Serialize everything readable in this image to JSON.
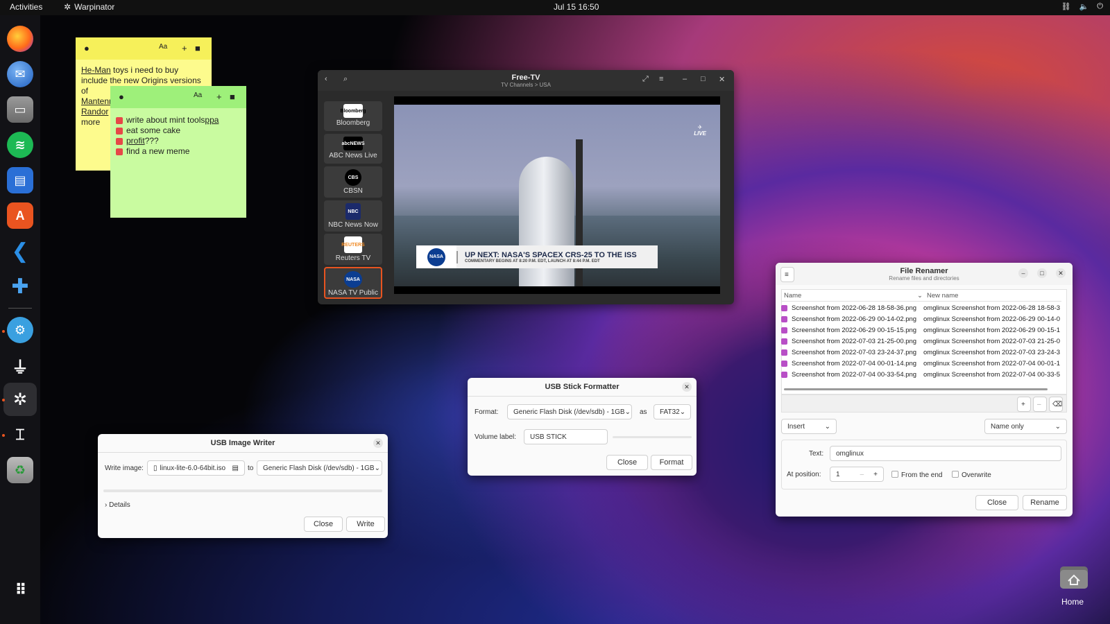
{
  "topbar": {
    "activities": "Activities",
    "app_name": "Warpinator",
    "clock": "Jul 15  16:50"
  },
  "dock": {
    "apps": [
      "firefox-icon",
      "thunderbird-icon",
      "files-icon",
      "spotify-icon",
      "writer-icon",
      "software-icon",
      "vscode-icon",
      "extensions-icon",
      "gear-icon",
      "usb-icon",
      "warpinator-icon",
      "renamer-icon",
      "trash-icon",
      "show-apps-icon"
    ]
  },
  "note_yellow": {
    "color": "#fdfb8d",
    "lines": [
      "He-Man",
      " toys i need to buy include the new Origins versions of ",
      "Mantenna",
      "Randor",
      "more"
    ]
  },
  "note_green": {
    "color": "#c9fba0",
    "items": [
      {
        "text": "write about mint tools ",
        "u": "ppa"
      },
      {
        "text": "eat some cake",
        "u": ""
      },
      {
        "text": "",
        "u": "profit",
        "tail": " ???"
      },
      {
        "text": "find a new meme",
        "u": ""
      }
    ]
  },
  "freetv": {
    "title": "Free-TV",
    "subtitle": "TV Channels > USA",
    "channels": [
      {
        "name": "Bloomberg",
        "logo": "Bloomberg"
      },
      {
        "name": "ABC News Live",
        "logo": "abcNEWS"
      },
      {
        "name": "CBSN",
        "logo": "CBS"
      },
      {
        "name": "NBC News Now",
        "logo": "NBC"
      },
      {
        "name": "Reuters TV",
        "logo": "REUTERS"
      },
      {
        "name": "NASA TV Public",
        "logo": "NASA"
      }
    ],
    "banner_line1": "UP NEXT: NASA'S SPACEX CRS-25 TO THE ISS",
    "banner_line2": "COMMENTARY BEGINS AT 8:20 P.M. EDT, LAUNCH AT 8:44 P.M. EDT",
    "banner_logo": "NASA",
    "live": "LIVE"
  },
  "usb_writer": {
    "title": "USB Image Writer",
    "write_label": "Write image:",
    "image": "linux-lite-6.0-64bit.iso",
    "to_label": "to",
    "device": "Generic Flash Disk (/dev/sdb) - 1GB",
    "details": "Details",
    "close": "Close",
    "write": "Write"
  },
  "usb_formatter": {
    "title": "USB Stick Formatter",
    "format_label": "Format:",
    "device": "Generic Flash Disk (/dev/sdb) - 1GB",
    "as_label": "as",
    "fs": "FAT32",
    "volume_label": "Volume label:",
    "volume_value": "USB STICK",
    "close": "Close",
    "format": "Format"
  },
  "renamer": {
    "title": "File Renamer",
    "subtitle": "Rename files and directories",
    "col_name": "Name",
    "col_new": "New name",
    "rows": [
      [
        "Screenshot from 2022-06-28 18-58-36.png",
        "omglinux Screenshot from 2022-06-28 18-58-3"
      ],
      [
        "Screenshot from 2022-06-29 00-14-02.png",
        "omglinux Screenshot from 2022-06-29 00-14-0"
      ],
      [
        "Screenshot from 2022-06-29 00-15-15.png",
        "omglinux Screenshot from 2022-06-29 00-15-1"
      ],
      [
        "Screenshot from 2022-07-03 21-25-00.png",
        "omglinux Screenshot from 2022-07-03 21-25-0"
      ],
      [
        "Screenshot from 2022-07-03 23-24-37.png",
        "omglinux Screenshot from 2022-07-03 23-24-3"
      ],
      [
        "Screenshot from 2022-07-04 00-01-14.png",
        "omglinux Screenshot from 2022-07-04 00-01-1"
      ],
      [
        "Screenshot from 2022-07-04 00-33-54.png",
        "omglinux Screenshot from 2022-07-04 00-33-5"
      ]
    ],
    "mode": "Insert",
    "scope": "Name only",
    "text_label": "Text:",
    "text_value": "omglinux",
    "position_label": "At position:",
    "position_value": "1",
    "from_end": "From the end",
    "overwrite": "Overwrite",
    "close": "Close",
    "rename": "Rename"
  },
  "desktop": {
    "home_label": "Home"
  }
}
